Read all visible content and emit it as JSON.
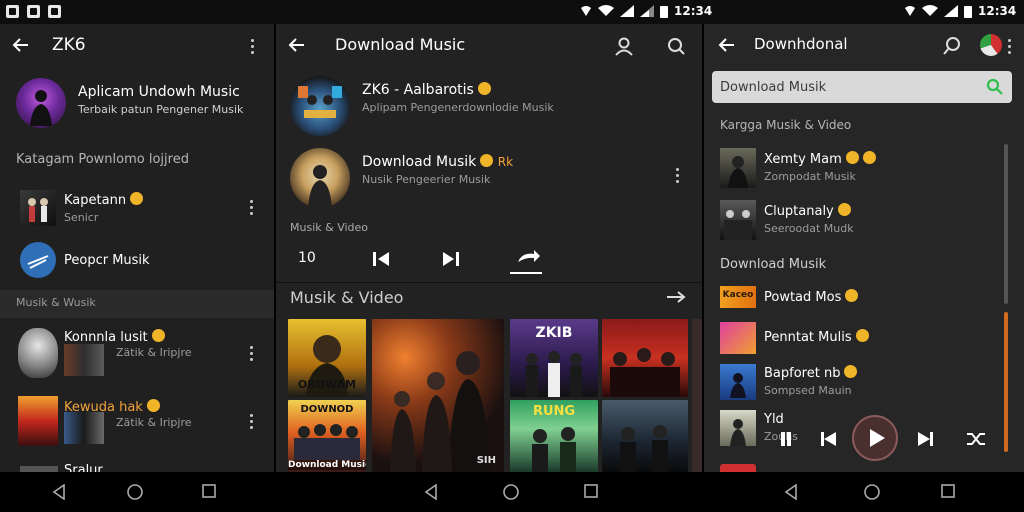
{
  "status_bar": {
    "time_middle": "12:34",
    "time_right": "12:34"
  },
  "panel1": {
    "title": "ZK6",
    "header": {
      "title": "Aplicam Undowh Music",
      "subtitle": "Terbaik patun Pengener Musik"
    },
    "section_download": "Katagam Pownlomo lojjred",
    "items": [
      {
        "title": "Kapetann",
        "subtitle": "Senicr"
      },
      {
        "title": "Peopcr Musik",
        "subtitle": ""
      }
    ],
    "section_music": "Musik & Wusik",
    "music_items": [
      {
        "title": "Konnnla lusit",
        "subtitle": "Zätik & Iripjre"
      },
      {
        "title": "Kewuda hak",
        "subtitle": "Zätik & Iripjre"
      },
      {
        "title": "Sralur",
        "subtitle": ""
      }
    ]
  },
  "panel2": {
    "title": "Download Music",
    "cards": [
      {
        "title": "ZK6 - Aalbarotis",
        "subtitle": "Aplipam Pengenerdownlodie Musik"
      },
      {
        "title": "Download Musik",
        "extra": "Rk",
        "subtitle": "Nusik Pengeerier Musik"
      }
    ],
    "player_label": "Musik & Video",
    "player_counter": "10",
    "section_title": "Musik & Video",
    "tiles": [
      {
        "caption": "OROWAM",
        "bottom": ""
      },
      {
        "caption": "",
        "bottom": "SIH"
      },
      {
        "caption": "ZKIB",
        "bottom": ""
      },
      {
        "caption": "",
        "bottom": ""
      },
      {
        "caption": "DOWNOD",
        "bottom": "Download Music"
      },
      {
        "caption": "RUNG",
        "bottom": ""
      },
      {
        "caption": "",
        "bottom": ""
      }
    ]
  },
  "panel3": {
    "title": "Downhdonal",
    "search_placeholder": "Download Musik",
    "section1": "Kargga Musik & Video",
    "section1_items": [
      {
        "title": "Xemty Mam",
        "subtitle": "Zompodat Musik"
      },
      {
        "title": "Cluptanaly",
        "subtitle": "Seeroodat Mudk"
      }
    ],
    "section2": "Download Musik",
    "section2_items": [
      {
        "title": "Powtad Mos",
        "subtitle": "",
        "thumb_text": "Kaceo"
      },
      {
        "title": "Penntat Mulis",
        "subtitle": ""
      },
      {
        "title": "Bapforet nb",
        "subtitle": "Sompsed Mauin"
      },
      {
        "title": "Yld",
        "subtitle": "Zouhs"
      }
    ]
  },
  "colors": {
    "accent": "#f2a33a",
    "badge": "#f0b429",
    "search_icon": "#2fbf4a"
  },
  "icons": [
    "back-arrow-icon",
    "more-vert-icon",
    "profile-icon",
    "search-icon",
    "play-icon",
    "previous-icon",
    "next-icon",
    "shuffle-icon",
    "share-icon"
  ]
}
